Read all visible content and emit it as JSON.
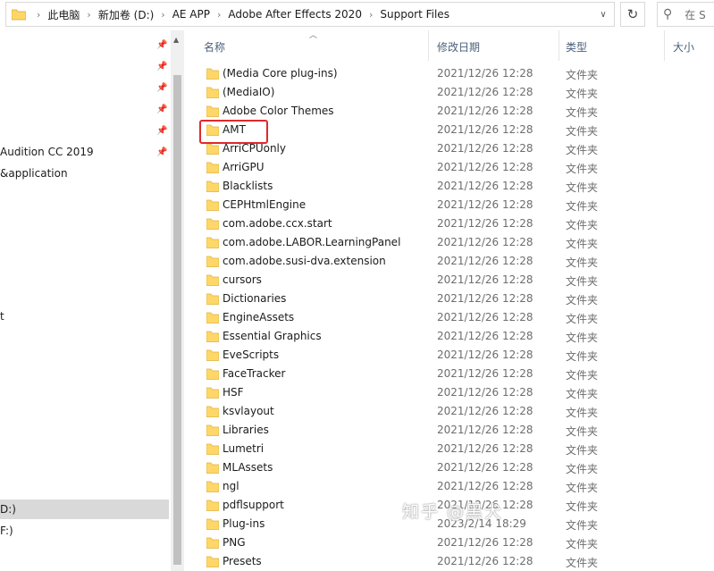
{
  "address_bar": {
    "breadcrumbs": [
      "此电脑",
      "新加卷 (D:)",
      "AE APP",
      "Adobe After Effects 2020",
      "Support Files"
    ]
  },
  "search": {
    "placeholder": "在 S"
  },
  "nav_pane": {
    "items": [
      {
        "label": "Audition CC 2019"
      },
      {
        "label": "&application"
      },
      {
        "label": "t"
      },
      {
        "label": "D:)"
      },
      {
        "label": "F:)"
      }
    ]
  },
  "columns": {
    "name": "名称",
    "date": "修改日期",
    "type": "类型",
    "size": "大小"
  },
  "files": [
    {
      "name": "(Media Core plug-ins)",
      "date": "2021/12/26 12:28",
      "type": "文件夹"
    },
    {
      "name": "(MediaIO)",
      "date": "2021/12/26 12:28",
      "type": "文件夹"
    },
    {
      "name": "Adobe Color Themes",
      "date": "2021/12/26 12:28",
      "type": "文件夹"
    },
    {
      "name": "AMT",
      "date": "2021/12/26 12:28",
      "type": "文件夹"
    },
    {
      "name": "ArriCPUonly",
      "date": "2021/12/26 12:28",
      "type": "文件夹"
    },
    {
      "name": "ArriGPU",
      "date": "2021/12/26 12:28",
      "type": "文件夹"
    },
    {
      "name": "Blacklists",
      "date": "2021/12/26 12:28",
      "type": "文件夹"
    },
    {
      "name": "CEPHtmlEngine",
      "date": "2021/12/26 12:28",
      "type": "文件夹"
    },
    {
      "name": "com.adobe.ccx.start",
      "date": "2021/12/26 12:28",
      "type": "文件夹"
    },
    {
      "name": "com.adobe.LABOR.LearningPanel",
      "date": "2021/12/26 12:28",
      "type": "文件夹"
    },
    {
      "name": "com.adobe.susi-dva.extension",
      "date": "2021/12/26 12:28",
      "type": "文件夹"
    },
    {
      "name": "cursors",
      "date": "2021/12/26 12:28",
      "type": "文件夹"
    },
    {
      "name": "Dictionaries",
      "date": "2021/12/26 12:28",
      "type": "文件夹"
    },
    {
      "name": "EngineAssets",
      "date": "2021/12/26 12:28",
      "type": "文件夹"
    },
    {
      "name": "Essential Graphics",
      "date": "2021/12/26 12:28",
      "type": "文件夹"
    },
    {
      "name": "EveScripts",
      "date": "2021/12/26 12:28",
      "type": "文件夹"
    },
    {
      "name": "FaceTracker",
      "date": "2021/12/26 12:28",
      "type": "文件夹"
    },
    {
      "name": "HSF",
      "date": "2021/12/26 12:28",
      "type": "文件夹"
    },
    {
      "name": "ksvlayout",
      "date": "2021/12/26 12:28",
      "type": "文件夹"
    },
    {
      "name": "Libraries",
      "date": "2021/12/26 12:28",
      "type": "文件夹"
    },
    {
      "name": "Lumetri",
      "date": "2021/12/26 12:28",
      "type": "文件夹"
    },
    {
      "name": "MLAssets",
      "date": "2021/12/26 12:28",
      "type": "文件夹"
    },
    {
      "name": "ngl",
      "date": "2021/12/26 12:28",
      "type": "文件夹"
    },
    {
      "name": "pdflsupport",
      "date": "2021/12/26 12:28",
      "type": "文件夹"
    },
    {
      "name": "Plug-ins",
      "date": "2023/2/14 18:29",
      "type": "文件夹"
    },
    {
      "name": "PNG",
      "date": "2021/12/26 12:28",
      "type": "文件夹"
    },
    {
      "name": "Presets",
      "date": "2021/12/26 12:28",
      "type": "文件夹"
    }
  ],
  "watermark": "知乎 @黑犬",
  "colors": {
    "folder": "#ffd768",
    "highlight": "#e0282c",
    "selection": "#cce8ff"
  }
}
